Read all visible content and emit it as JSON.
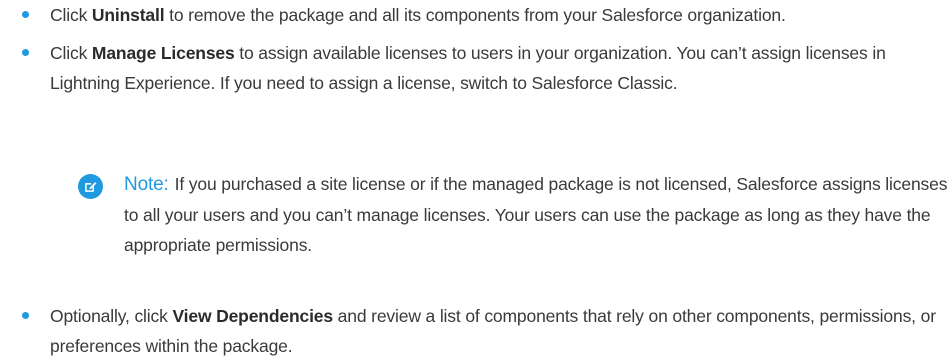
{
  "items": [
    {
      "pre": "Click ",
      "bold": "Uninstall",
      "post": " to remove the package and all its components from your Salesforce organization."
    },
    {
      "pre": "Click ",
      "bold": "Manage Licenses",
      "post": " to assign available licenses to users in your organization. You can’t assign licenses in Lightning Experience. If you need to assign a license, switch to Salesforce Classic."
    },
    {
      "pre": "Optionally, click ",
      "bold": "View Dependencies",
      "post": " and review a list of components that rely on other components, permissions, or preferences within the package."
    }
  ],
  "note": {
    "label": "Note:",
    "text": "If you purchased a site license or if the managed package is not licensed, Salesforce assigns licenses to all your users and you can’t manage licenses. Your users can use the package as long as they have the appropriate permissions.",
    "icon": "note-edit-icon"
  },
  "colors": {
    "accent": "#1f9ae0",
    "text": "#3a3a3a"
  }
}
